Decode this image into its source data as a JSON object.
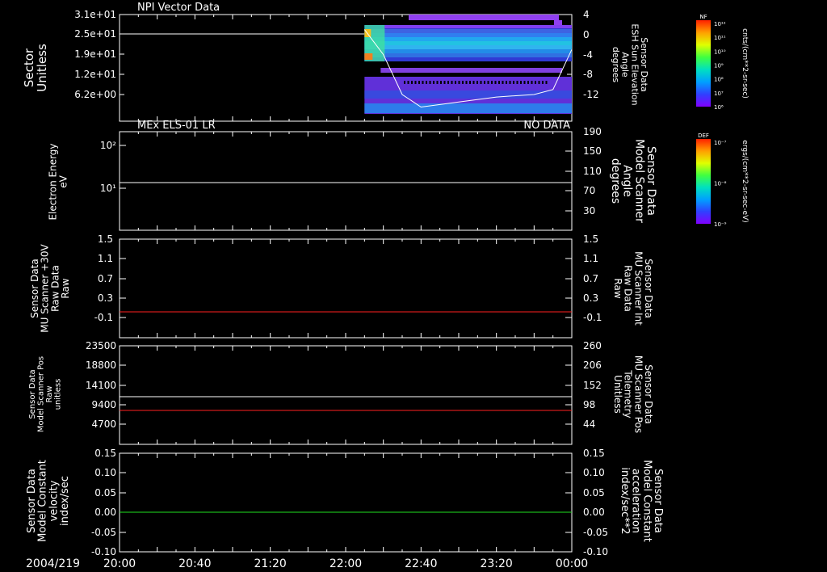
{
  "colors": {
    "white": "#ffffff",
    "red": "#ff2020",
    "green": "#20e020",
    "black": "#000000"
  },
  "footer": {
    "date": "2004/219"
  },
  "colorbars": [
    {
      "title": "NF",
      "units": "cnts/(cm**2-sr-sec)",
      "ticks": [
        "10¹²",
        "10¹¹",
        "10¹⁰",
        "10⁹",
        "10⁸",
        "10⁷",
        "10⁶"
      ]
    },
    {
      "title": "DEF",
      "units": "ergs/(cm**2-sr-sec-eV)",
      "ticks": [
        "10⁻⁷",
        "10⁻⁸",
        "10⁻⁹"
      ]
    }
  ],
  "chart_data": [
    {
      "type": "heatmap",
      "title": "NPI Vector Data",
      "ylabel_left": [
        "Sector",
        "Unitless"
      ],
      "ylabel_right": [
        "Sensor Data",
        "ESH Sun Elevation",
        "Angle",
        "degrees"
      ],
      "left_ticks": [
        "3.1e+01",
        "2.5e+01",
        "1.9e+01",
        "1.2e+01",
        "6.2e+00"
      ],
      "right_ticks": [
        "4",
        "0",
        "-4",
        "-8",
        "-12"
      ],
      "x_range": [
        "20:00",
        "00:00"
      ],
      "heatmap_start": "22:10",
      "left_line_value": 25,
      "right_curve": {
        "series": "ESH Sun Elevation",
        "x": [
          "22:10",
          "22:20",
          "22:30",
          "22:40",
          "23:00",
          "23:20",
          "23:40",
          "23:50",
          "00:00"
        ],
        "y": [
          1,
          -4,
          -12,
          -14.5,
          -13.5,
          -12.5,
          -12,
          -11,
          -3
        ]
      }
    },
    {
      "type": "line",
      "title": "MEx ELS-01 LR",
      "status": "NO DATA",
      "ylabel_left": [
        "Electron Energy",
        "eV"
      ],
      "ylabel_right": [
        "Sensor Data",
        "Model Scanner",
        "Angle",
        "degrees"
      ],
      "left_ticks": [
        "10²",
        "10¹"
      ],
      "right_ticks": [
        "190",
        "150",
        "110",
        "70",
        "30"
      ],
      "series": [
        {
          "axis": "right",
          "color": "white",
          "value": 90
        }
      ]
    },
    {
      "type": "line",
      "ylabel_left": [
        "Sensor Data",
        "MU Scanner +30V",
        "Raw Data",
        "Raw"
      ],
      "ylabel_right": [
        "Sensor Data",
        "MU Scanner Int",
        "Raw Data",
        "Raw"
      ],
      "left_ticks": [
        "1.5",
        "1.1",
        "0.7",
        "0.3",
        "-0.1"
      ],
      "right_ticks": [
        "1.5",
        "1.1",
        "0.7",
        "0.3",
        "-0.1"
      ],
      "ylim": [
        -0.45,
        1.5
      ],
      "series": [
        {
          "axis": "right",
          "color": "red",
          "value": 0
        }
      ]
    },
    {
      "type": "line",
      "ylabel_left": [
        "Sensor Data",
        "Model Scanner Pos",
        "Raw",
        "unitless"
      ],
      "ylabel_right": [
        "Sensor Data",
        "MU Scanner Pos",
        "Telemetry",
        "Unitless"
      ],
      "left_ticks": [
        "23500",
        "18800",
        "14100",
        "9400",
        "4700"
      ],
      "right_ticks": [
        "260",
        "206",
        "152",
        "98",
        "44"
      ],
      "ylim_left": [
        0,
        23500
      ],
      "series": [
        {
          "axis": "left",
          "color": "white",
          "value": 11250
        },
        {
          "axis": "right",
          "color": "red",
          "value": 80
        }
      ]
    },
    {
      "type": "line",
      "ylabel_left": [
        "Sensor Data",
        "Model Constant",
        "velocity",
        "index/sec"
      ],
      "ylabel_right": [
        "Sensor Data",
        "Model Constant",
        "acceleration",
        "index/sec**2"
      ],
      "left_ticks": [
        "0.15",
        "0.10",
        "0.05",
        "0.00",
        "-0.05",
        "-0.10"
      ],
      "right_ticks": [
        "0.15",
        "0.10",
        "0.05",
        "0.00",
        "-0.05",
        "-0.10"
      ],
      "ylim": [
        -0.1,
        0.15
      ],
      "series": [
        {
          "axis": "right",
          "color": "green",
          "value": 0
        }
      ]
    }
  ],
  "x_axis": {
    "ticks": [
      "20:00",
      "20:40",
      "21:20",
      "22:00",
      "22:40",
      "23:20",
      "00:00"
    ]
  }
}
